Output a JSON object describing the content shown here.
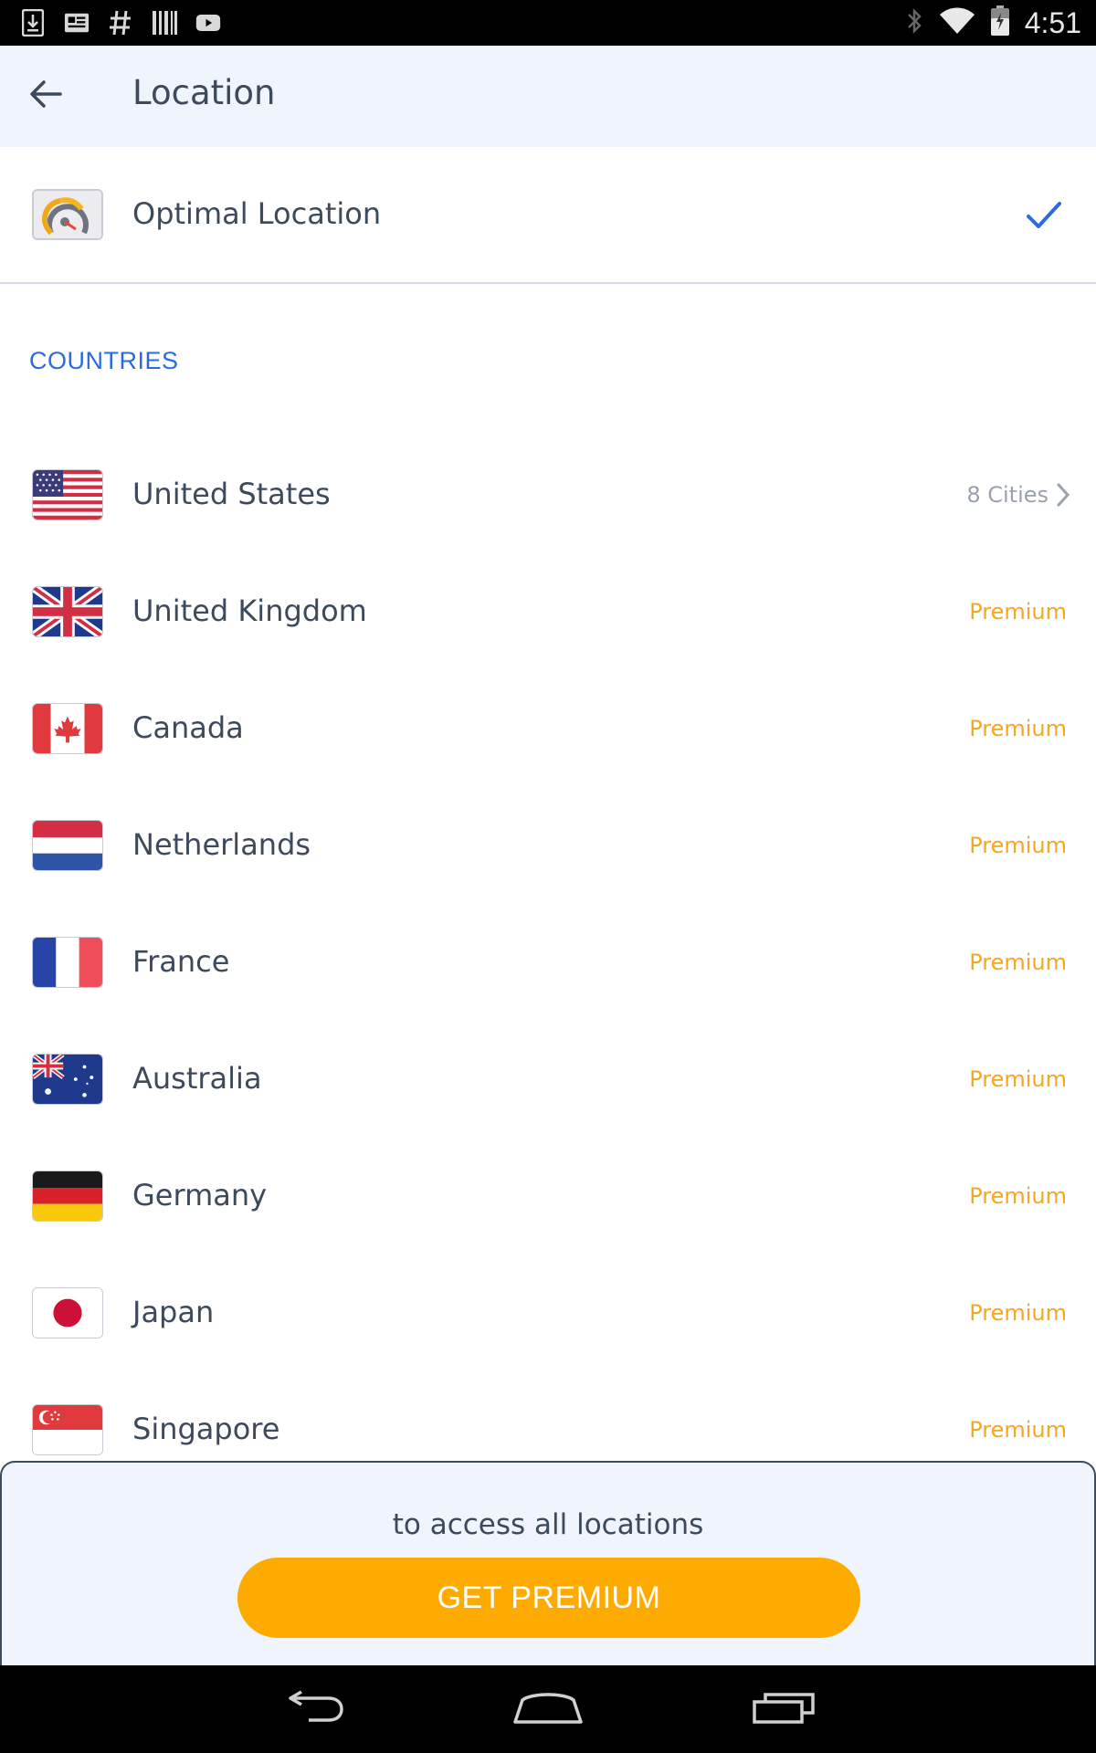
{
  "status_bar": {
    "time": "4:51",
    "left_icons": [
      "download-icon",
      "news-icon",
      "hash-icon",
      "barcode-icon",
      "youtube-icon"
    ],
    "right_icons": [
      "bluetooth-icon",
      "wifi-icon",
      "battery-icon"
    ]
  },
  "app_bar": {
    "title": "Location",
    "back_icon": "arrow-left-icon"
  },
  "optimal": {
    "label": "Optimal Location",
    "selected": true
  },
  "section": {
    "countries_header": "COUNTRIES"
  },
  "countries": [
    {
      "name": "United States",
      "tag": "8 Cities",
      "flag": "us-flag-icon"
    },
    {
      "name": "United Kingdom",
      "tag": "Premium",
      "flag": "uk-flag-icon"
    },
    {
      "name": "Canada",
      "tag": "Premium",
      "flag": "canada-flag-icon"
    },
    {
      "name": "Netherlands",
      "tag": "Premium",
      "flag": "netherlands-flag-icon"
    },
    {
      "name": "France",
      "tag": "Premium",
      "flag": "france-flag-icon"
    },
    {
      "name": "Australia",
      "tag": "Premium",
      "flag": "australia-flag-icon"
    },
    {
      "name": "Germany",
      "tag": "Premium",
      "flag": "germany-flag-icon"
    },
    {
      "name": "Japan",
      "tag": "Premium",
      "flag": "japan-flag-icon"
    },
    {
      "name": "Singapore",
      "tag": "Premium",
      "flag": "singapore-flag-icon"
    }
  ],
  "premium": {
    "message": "to access all locations",
    "button_label": "GET PREMIUM"
  },
  "colors": {
    "accent_blue": "#2a6be0",
    "premium_orange": "#f5a623",
    "button_orange": "#fdab00",
    "text": "#3d4a5c",
    "header_bg": "#f0f4fc"
  }
}
